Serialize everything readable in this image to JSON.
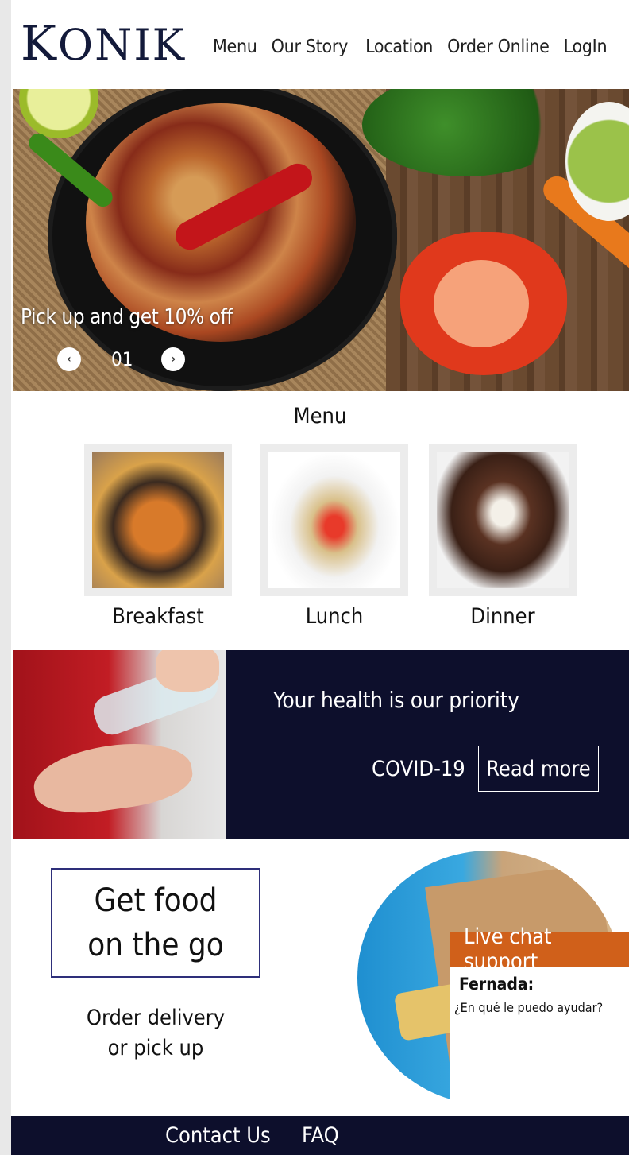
{
  "header": {
    "logo_first": "K",
    "logo_rest": "ONIK",
    "nav": [
      "Menu",
      "Our Story",
      "Location",
      "Order Online",
      "LogIn"
    ]
  },
  "hero": {
    "caption": "Pick up and get 10% off",
    "slide_number": "01",
    "prev_icon": "chevron-left-icon",
    "next_icon": "chevron-right-icon"
  },
  "menu": {
    "title": "Menu",
    "items": [
      {
        "label": "Breakfast"
      },
      {
        "label": "Lunch"
      },
      {
        "label": "Dinner"
      }
    ]
  },
  "covid": {
    "title": "Your health is our priority",
    "tag": "COVID-19",
    "button": "Read more"
  },
  "go": {
    "line1": "Get food",
    "line2": "on the go",
    "sub1": "Order delivery",
    "sub2": "or pick up"
  },
  "chat": {
    "title": "Live chat support",
    "agent": "Fernada:",
    "message": "¿En qué le puedo ayudar?"
  },
  "footer": {
    "links": [
      "Contact Us",
      "FAQ"
    ]
  },
  "colors": {
    "navy": "#0d0f2c",
    "chat_orange": "#d0601a",
    "box_border": "#2e2f7a"
  }
}
